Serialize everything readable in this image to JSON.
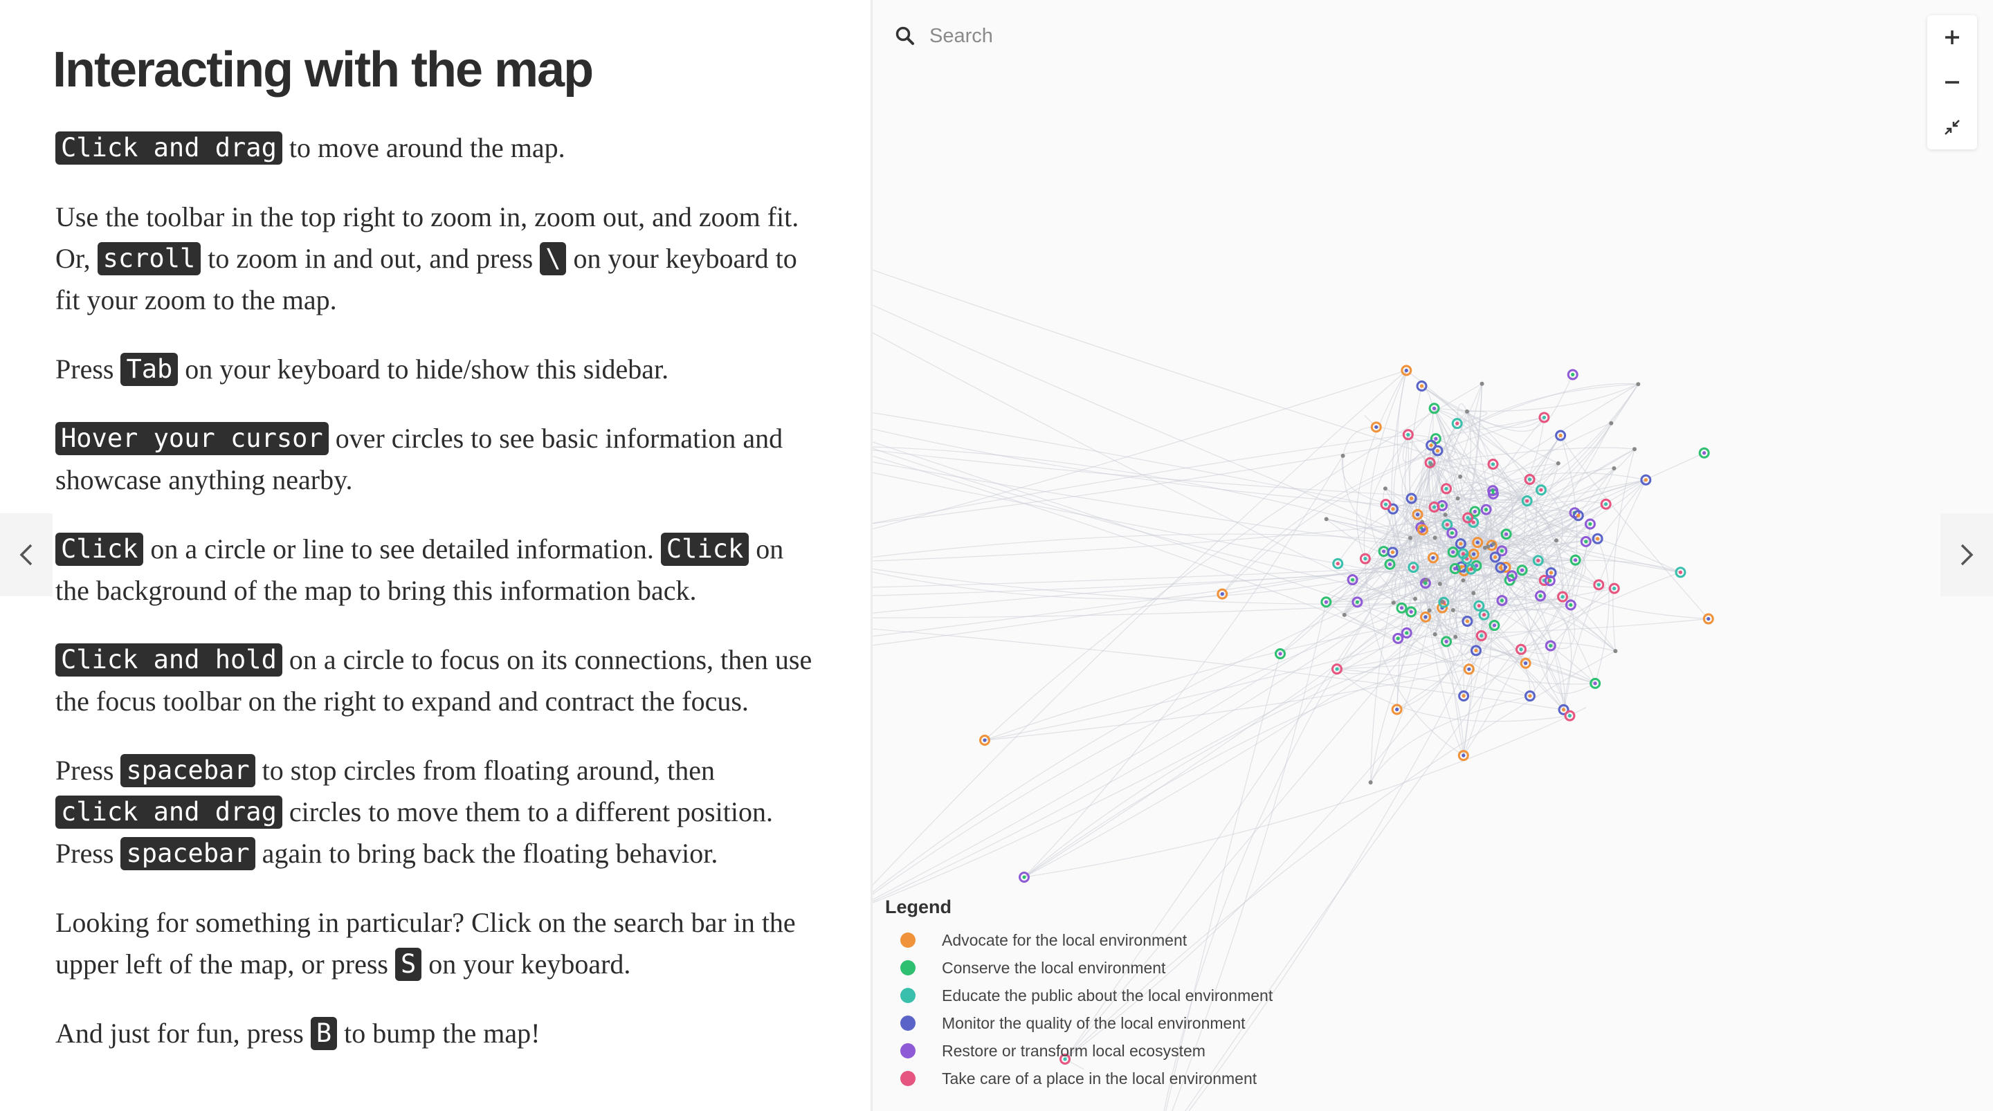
{
  "sidebar": {
    "title": "Interacting with the map",
    "paragraphs": [
      [
        {
          "k": "Click and drag"
        },
        {
          "t": " to move around the map."
        }
      ],
      [
        {
          "t": "Use the toolbar in the top right to zoom in, zoom out, and zoom fit. Or, "
        },
        {
          "k": "scroll"
        },
        {
          "t": " to zoom in and out, and press "
        },
        {
          "k": "\\"
        },
        {
          "t": " on your keyboard to fit your zoom to the map."
        }
      ],
      [
        {
          "t": "Press "
        },
        {
          "k": "Tab"
        },
        {
          "t": " on your keyboard to hide/show this sidebar."
        }
      ],
      [
        {
          "k": "Hover your cursor"
        },
        {
          "t": " over circles to see basic information and showcase anything nearby."
        }
      ],
      [
        {
          "k": "Click"
        },
        {
          "t": " on a circle or line to see detailed information. "
        },
        {
          "k": "Click"
        },
        {
          "t": " on the background of the map to bring this information back."
        }
      ],
      [
        {
          "k": "Click and hold"
        },
        {
          "t": " on a circle to focus on its connections, then use the focus toolbar on the right to expand and contract the focus."
        }
      ],
      [
        {
          "t": "Press "
        },
        {
          "k": "spacebar"
        },
        {
          "t": " to stop circles from floating around, then "
        },
        {
          "k": "click and drag"
        },
        {
          "t": " circles to move them to a different position. Press "
        },
        {
          "k": "spacebar"
        },
        {
          "t": " again to bring back the floating behavior."
        }
      ],
      [
        {
          "t": "Looking for something in particular? Click on the search bar in the upper left of the map, or press "
        },
        {
          "k": "S"
        },
        {
          "t": " on your keyboard."
        }
      ],
      [
        {
          "t": "And just for fun, press "
        },
        {
          "k": "B"
        },
        {
          "t": " to bump the map!"
        }
      ]
    ]
  },
  "nav": {
    "prev_icon": "chevron-left-icon",
    "next_icon": "chevron-right-icon"
  },
  "map": {
    "search": {
      "placeholder": "Search",
      "icon": "search-icon"
    },
    "toolbar": {
      "zoom_in_icon": "plus-icon",
      "zoom_out_icon": "minus-icon",
      "zoom_fit_icon": "collapse-arrows-icon"
    },
    "legend": {
      "title": "Legend",
      "items": [
        {
          "label": "Advocate for the local environment",
          "color": "#f0923a"
        },
        {
          "label": "Conserve the local environment",
          "color": "#2fbf71"
        },
        {
          "label": "Educate the public about the local environment",
          "color": "#3bbfad"
        },
        {
          "label": "Monitor the quality of the local environment",
          "color": "#5a64c8"
        },
        {
          "label": "Restore or transform local ecosystem",
          "color": "#8e5ad6"
        },
        {
          "label": "Take care of a place in the local environment",
          "color": "#e6557f"
        }
      ]
    }
  }
}
